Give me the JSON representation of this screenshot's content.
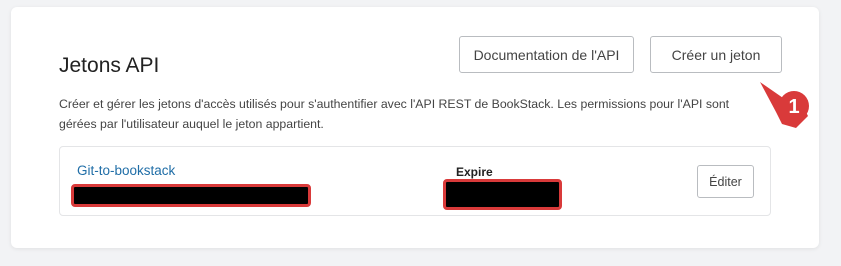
{
  "header": {
    "title": "Jetons API",
    "docs_button": "Documentation de l'API",
    "create_button": "Créer un jeton"
  },
  "description": "Créer et gérer les jetons d'accès utilisés pour s'authentifier avec l'API REST de BookStack. Les permissions pour l'API sont gérées par l'utilisateur auquel le jeton appartient.",
  "tokens": [
    {
      "name": "Git-to-bookstack",
      "expire_label": "Expire",
      "edit_button": "Éditer"
    }
  ],
  "annotation": {
    "number": "1",
    "color": "#d93a3a"
  },
  "colors": {
    "link": "#206ea7",
    "redaction_border": "#d93a3a",
    "page_background": "#f2f3f5"
  }
}
